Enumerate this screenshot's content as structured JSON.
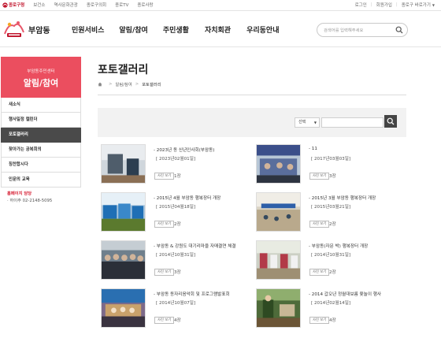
{
  "topbar": {
    "brand": "종로구청",
    "links": [
      "보건소",
      "역사문화관광",
      "종로구의회",
      "종로TV",
      "종로사랑"
    ],
    "login": "로그인",
    "signup": "회원가입",
    "dong_select": "종로구 바로가기"
  },
  "header": {
    "dong_name": "부암동",
    "gnb": [
      "민원서비스",
      "알림/참여",
      "주민생활",
      "자치회관",
      "우리동안내"
    ],
    "search_placeholder": "검색어를 입력해주세요"
  },
  "sidebar": {
    "subtitle": "부암동주민센터",
    "title": "알림/참여",
    "menu": [
      {
        "label": "새소식",
        "active": false
      },
      {
        "label": "행사일정 캘린더",
        "active": false
      },
      {
        "label": "포토갤러리",
        "active": true
      },
      {
        "label": "찾아가는 공복회의",
        "active": false
      },
      {
        "label": "칭찬합시다",
        "active": false
      },
      {
        "label": "인문의 교육",
        "active": false
      }
    ],
    "contact_title": "홈페이지 담당",
    "contact_tel": "하이주 02-2148-5095"
  },
  "content": {
    "page_title": "포토갤러리",
    "breadcrumb": [
      "홈",
      "알림/참여",
      "포토갤러리"
    ],
    "search": {
      "select_value": "선택"
    },
    "items": [
      {
        "title": "2023년 동 신년인사회(부암동)",
        "date": "[ 2023년02월01일]",
        "badge": "사진 보기",
        "count": "1장"
      },
      {
        "title": "11",
        "date": "[ 2017년03월03일]",
        "badge": "사진 보기",
        "count": "3장"
      },
      {
        "title": "2015년 4월 부암동 행복장터 개장",
        "date": "[ 2015년04월18일]",
        "badge": "사진 보기",
        "count": "2장"
      },
      {
        "title": "2015년 3월 부암동 행복장터 개장",
        "date": "[ 2015년03월21일]",
        "badge": "사진 보기",
        "count": "2장"
      },
      {
        "title": "부암동 & 강원도 대기리마을 자매결연 체결",
        "date": "[ 2014년10월31일]",
        "badge": "사진 보기",
        "count": "3장"
      },
      {
        "title": "부암동(자문 박) 행복장터 개장",
        "date": "[ 2014년10월31일]",
        "badge": "사진 보기",
        "count": "2장"
      },
      {
        "title": "부암동 동자리음악회 및 프로그램발표회",
        "date": "[ 2014년10월07일]",
        "badge": "사진 보기",
        "count": "4장"
      },
      {
        "title": "2014 갑오년 정월대보름 윷놀이 행사",
        "date": "[ 2014년02월14일]",
        "badge": "사진 보기",
        "count": "4장"
      }
    ]
  },
  "colors": {
    "accent": "#eb4e5f",
    "brand_red": "#c0142c",
    "active_menu": "#4a4a4a"
  },
  "icons": [
    "logo-emblem-icon",
    "search-icon",
    "home-icon",
    "chevron-down-icon"
  ]
}
